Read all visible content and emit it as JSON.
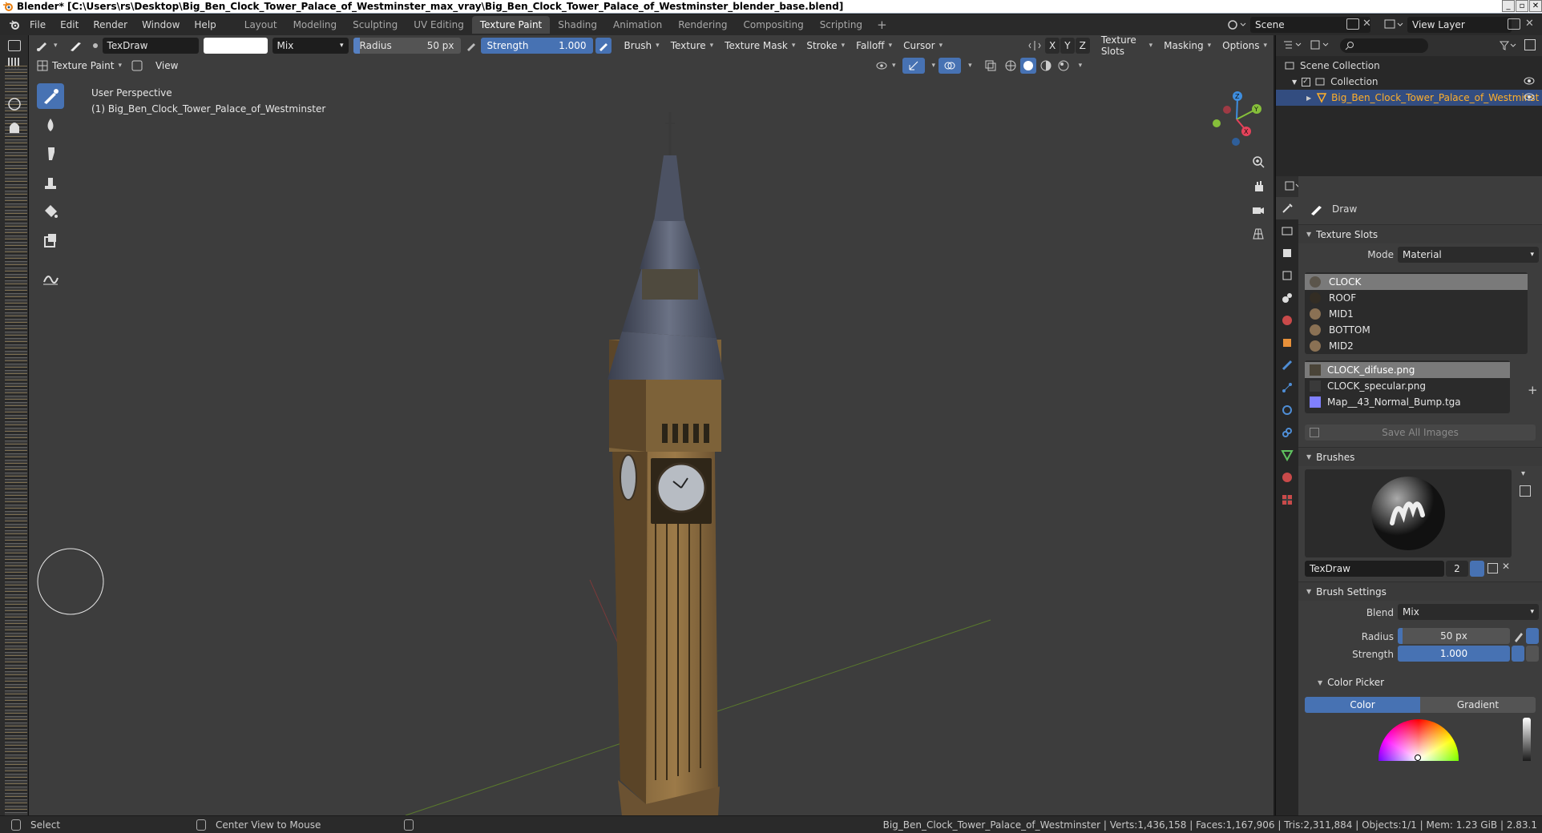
{
  "window": {
    "title": "Blender* [C:\\Users\\rs\\Desktop\\Big_Ben_Clock_Tower_Palace_of_Westminster_max_vray\\Big_Ben_Clock_Tower_Palace_of_Westminster_blender_base.blend]",
    "controls": [
      "_",
      "▫",
      "✕"
    ]
  },
  "menu": [
    "File",
    "Edit",
    "Render",
    "Window",
    "Help"
  ],
  "workspaces": [
    "Layout",
    "Modeling",
    "Sculpting",
    "UV Editing",
    "Texture Paint",
    "Shading",
    "Animation",
    "Rendering",
    "Compositing",
    "Scripting"
  ],
  "active_workspace": "Texture Paint",
  "scene": "Scene",
  "view_layer": "View Layer",
  "tool_header": {
    "brush_name": "TexDraw",
    "blend": "Mix",
    "radius_label": "Radius",
    "radius_value": "50 px",
    "strength_label": "Strength",
    "strength_value": "1.000",
    "menus": [
      "Brush",
      "Texture",
      "Texture Mask",
      "Stroke",
      "Falloff",
      "Cursor"
    ],
    "axes": [
      "X",
      "Y",
      "Z"
    ],
    "right_menus": [
      "Texture Slots",
      "Masking",
      "Options"
    ]
  },
  "viewport_header": {
    "mode": "Texture Paint",
    "view": "View"
  },
  "viewport": {
    "perspective": "User Perspective",
    "object_label": "(1) Big_Ben_Clock_Tower_Palace_of_Westminster",
    "gizmo_axes": [
      "Z",
      "Y",
      "X"
    ]
  },
  "outliner": {
    "root": "Scene Collection",
    "collection": "Collection",
    "object": "Big_Ben_Clock_Tower_Palace_of_Westminst"
  },
  "properties": {
    "tool_name": "Draw",
    "texture_slots": {
      "title": "Texture Slots",
      "mode_label": "Mode",
      "mode_value": "Material",
      "materials": [
        "CLOCK",
        "ROOF",
        "MID1",
        "BOTTOM",
        "MID2"
      ],
      "images": [
        "CLOCK_difuse.png",
        "CLOCK_specular.png",
        "Map__43_Normal_Bump.tga"
      ],
      "save_all": "Save All Images"
    },
    "brushes": {
      "title": "Brushes",
      "brush_name": "TexDraw",
      "users": "2"
    },
    "brush_settings": {
      "title": "Brush Settings",
      "blend_label": "Blend",
      "blend_value": "Mix",
      "radius_label": "Radius",
      "radius_value": "50 px",
      "strength_label": "Strength",
      "strength_value": "1.000"
    },
    "color_picker": {
      "title": "Color Picker",
      "tab_color": "Color",
      "tab_gradient": "Gradient"
    }
  },
  "statusbar": {
    "select": "Select",
    "center_view": "Center View to Mouse",
    "stats": "Big_Ben_Clock_Tower_Palace_of_Westminster | Verts:1,436,158 | Faces:1,167,906 | Tris:2,311,884 | Objects:1/1 | Mem: 1.23 GiB | 2.83.1"
  },
  "colors": {
    "accent_blue": "#4772b3",
    "viewport_bg": "#3d3d3d",
    "selected_object": "#ffaf29",
    "x_axis": "#e5425a",
    "y_axis": "#86bf3a",
    "z_axis": "#3e8ee0"
  }
}
